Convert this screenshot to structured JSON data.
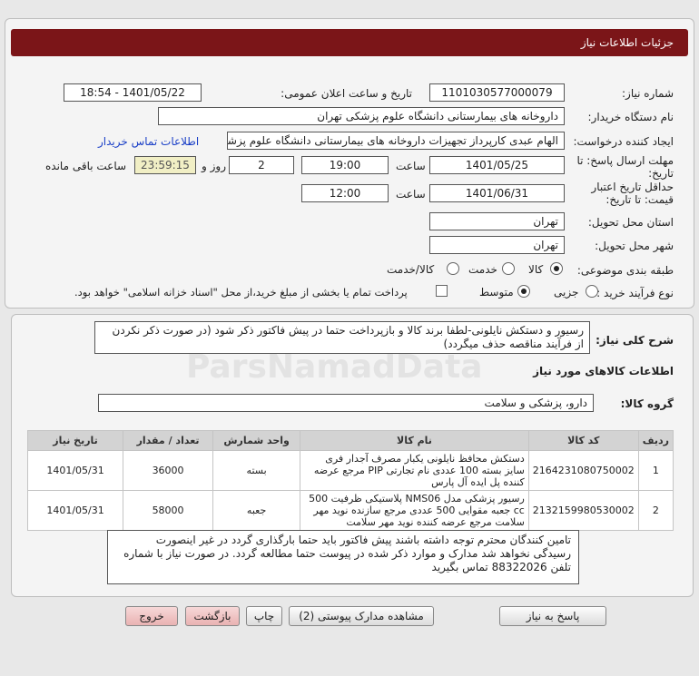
{
  "header": {
    "title": "جزئیات اطلاعات نیاز"
  },
  "fields": {
    "need_number_label": "شماره نیاز:",
    "need_number": "1101030577000079",
    "announce_label": "تاریخ و ساعت اعلان عمومی:",
    "announce_value": "1401/05/22 - 18:54",
    "buyer_label": "نام دستگاه خریدار:",
    "buyer_value": "داروخانه های بیمارستانی دانشگاه علوم پزشکی تهران",
    "creator_label": "ایجاد کننده درخواست:",
    "creator_value": "الهام عبدی کارپرداز تجهیزات داروخانه های بیمارستانی دانشگاه علوم پزشکی تهران",
    "contact_link": "اطلاعات تماس خریدار",
    "deadline_label": "مهلت ارسال پاسخ: تا تاریخ:",
    "deadline_date": "1401/05/25",
    "time_label": "ساعت",
    "deadline_time": "19:00",
    "days_value": "2",
    "days_label": "روز و",
    "remaining_value": "23:59:15",
    "remaining_label": "ساعت باقی مانده",
    "validity_label": "حداقل تاریخ اعتبار قیمت: تا تاریخ:",
    "validity_date": "1401/06/31",
    "validity_time": "12:00",
    "province_label": "استان محل تحویل:",
    "province_value": "تهران",
    "city_label": "شهر محل تحویل:",
    "city_value": "تهران",
    "category_label": "طبقه بندی موضوعی:",
    "category_options": [
      "کالا",
      "خدمت",
      "کالا/خدمت"
    ],
    "process_label": "نوع فرآیند خرید :",
    "process_options": [
      "جزیی",
      "متوسط"
    ],
    "payment_note": "پرداخت تمام یا بخشی از مبلغ خرید،از محل \"اسناد خزانه اسلامی\" خواهد بود."
  },
  "description": {
    "label": "شرح کلی نیاز:",
    "text": "رسیور و دستکش نایلونی-لطفا برند کالا و بازپرداخت حتما در پیش فاکتور ذکر شود (در صورت ذکر نکردن از فرآیند مناقصه حذف میگردد)"
  },
  "goods": {
    "section_title": "اطلاعات کالاهای مورد نیاز",
    "group_label": "گروه کالا:",
    "group_value": "دارو، پزشکی و سلامت",
    "columns": [
      "ردیف",
      "کد کالا",
      "نام کالا",
      "واحد شمارش",
      "تعداد / مقدار",
      "تاریخ نیاز"
    ],
    "rows": [
      {
        "index": "1",
        "code": "2164231080750002",
        "name": "دستکش محافظ نایلونی یکبار مصرف آجدار فری سایز بسته 100 عددی نام تجارتی PIP مرجع عرضه کننده پل ایده آل پارس",
        "unit": "بسته",
        "qty": "36000",
        "date": "1401/05/31"
      },
      {
        "index": "2",
        "code": "2132159980530002",
        "name": "رسیور پزشکی مدل NMS06 پلاستیکی ظرفیت 500 cc جعبه مقوایی 500 عددی مرجع سازنده نوید مهر سلامت مرجع عرضه کننده نوید مهر سلامت",
        "unit": "جعبه",
        "qty": "58000",
        "date": "1401/05/31"
      }
    ]
  },
  "buyer_note": "تامین کنندگان محترم توجه داشته باشند پیش فاکتور باید حتما بارگذاری گردد در غیر اینصورت رسیدگی نخواهد شد مدارک و موارد ذکر شده در پیوست حتما مطالعه گردد. در صورت نیاز با شماره تلفن 88322026 تماس بگیرید",
  "buttons": {
    "reply": "پاسخ به نیاز",
    "attachments": "مشاهده مدارک پیوستی (2)",
    "print": "چاپ",
    "back": "بازگشت",
    "exit": "خروج"
  },
  "watermark": "ParsNamadData"
}
